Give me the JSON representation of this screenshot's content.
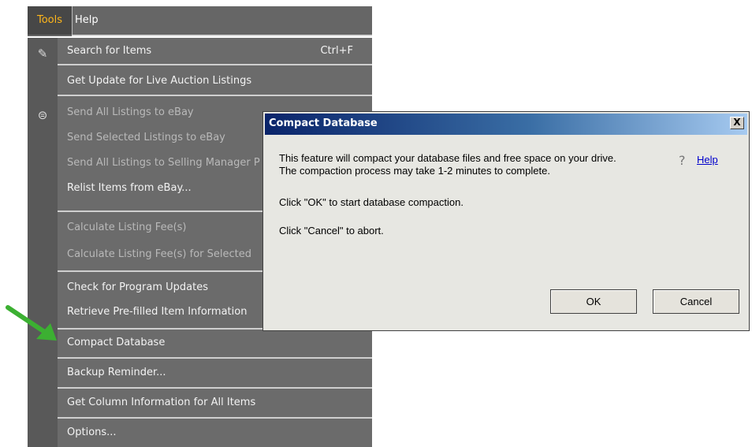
{
  "menubar": {
    "tools": "Tools",
    "help": "Help"
  },
  "menu": {
    "items": [
      {
        "label": "Search for Items",
        "shortcut": "Ctrl+F"
      },
      {
        "label": "Get Update for Live Auction Listings"
      },
      {
        "label": "Send All Listings to eBay"
      },
      {
        "label": "Send Selected Listings to eBay"
      },
      {
        "label": "Send All Listings to Selling Manager P"
      },
      {
        "label": "Relist Items from eBay..."
      },
      {
        "label": "Calculate Listing Fee(s)"
      },
      {
        "label": "Calculate Listing Fee(s) for Selected"
      },
      {
        "label": "Check for Program Updates"
      },
      {
        "label": "Retrieve Pre-filled Item Information"
      },
      {
        "label": "Compact Database"
      },
      {
        "label": "Backup Reminder..."
      },
      {
        "label": "Get Column Information for All Items"
      },
      {
        "label": "Options..."
      }
    ]
  },
  "dialog": {
    "title": "Compact Database",
    "close": "X",
    "line1": "This feature will compact your database files and free space on your drive.",
    "line2": "The compaction process may take 1-2 minutes to complete.",
    "line3": "Click \"OK\" to start database compaction.",
    "line4": "Click \"Cancel\" to abort.",
    "help": "Help",
    "ok": "OK",
    "cancel": "Cancel"
  }
}
